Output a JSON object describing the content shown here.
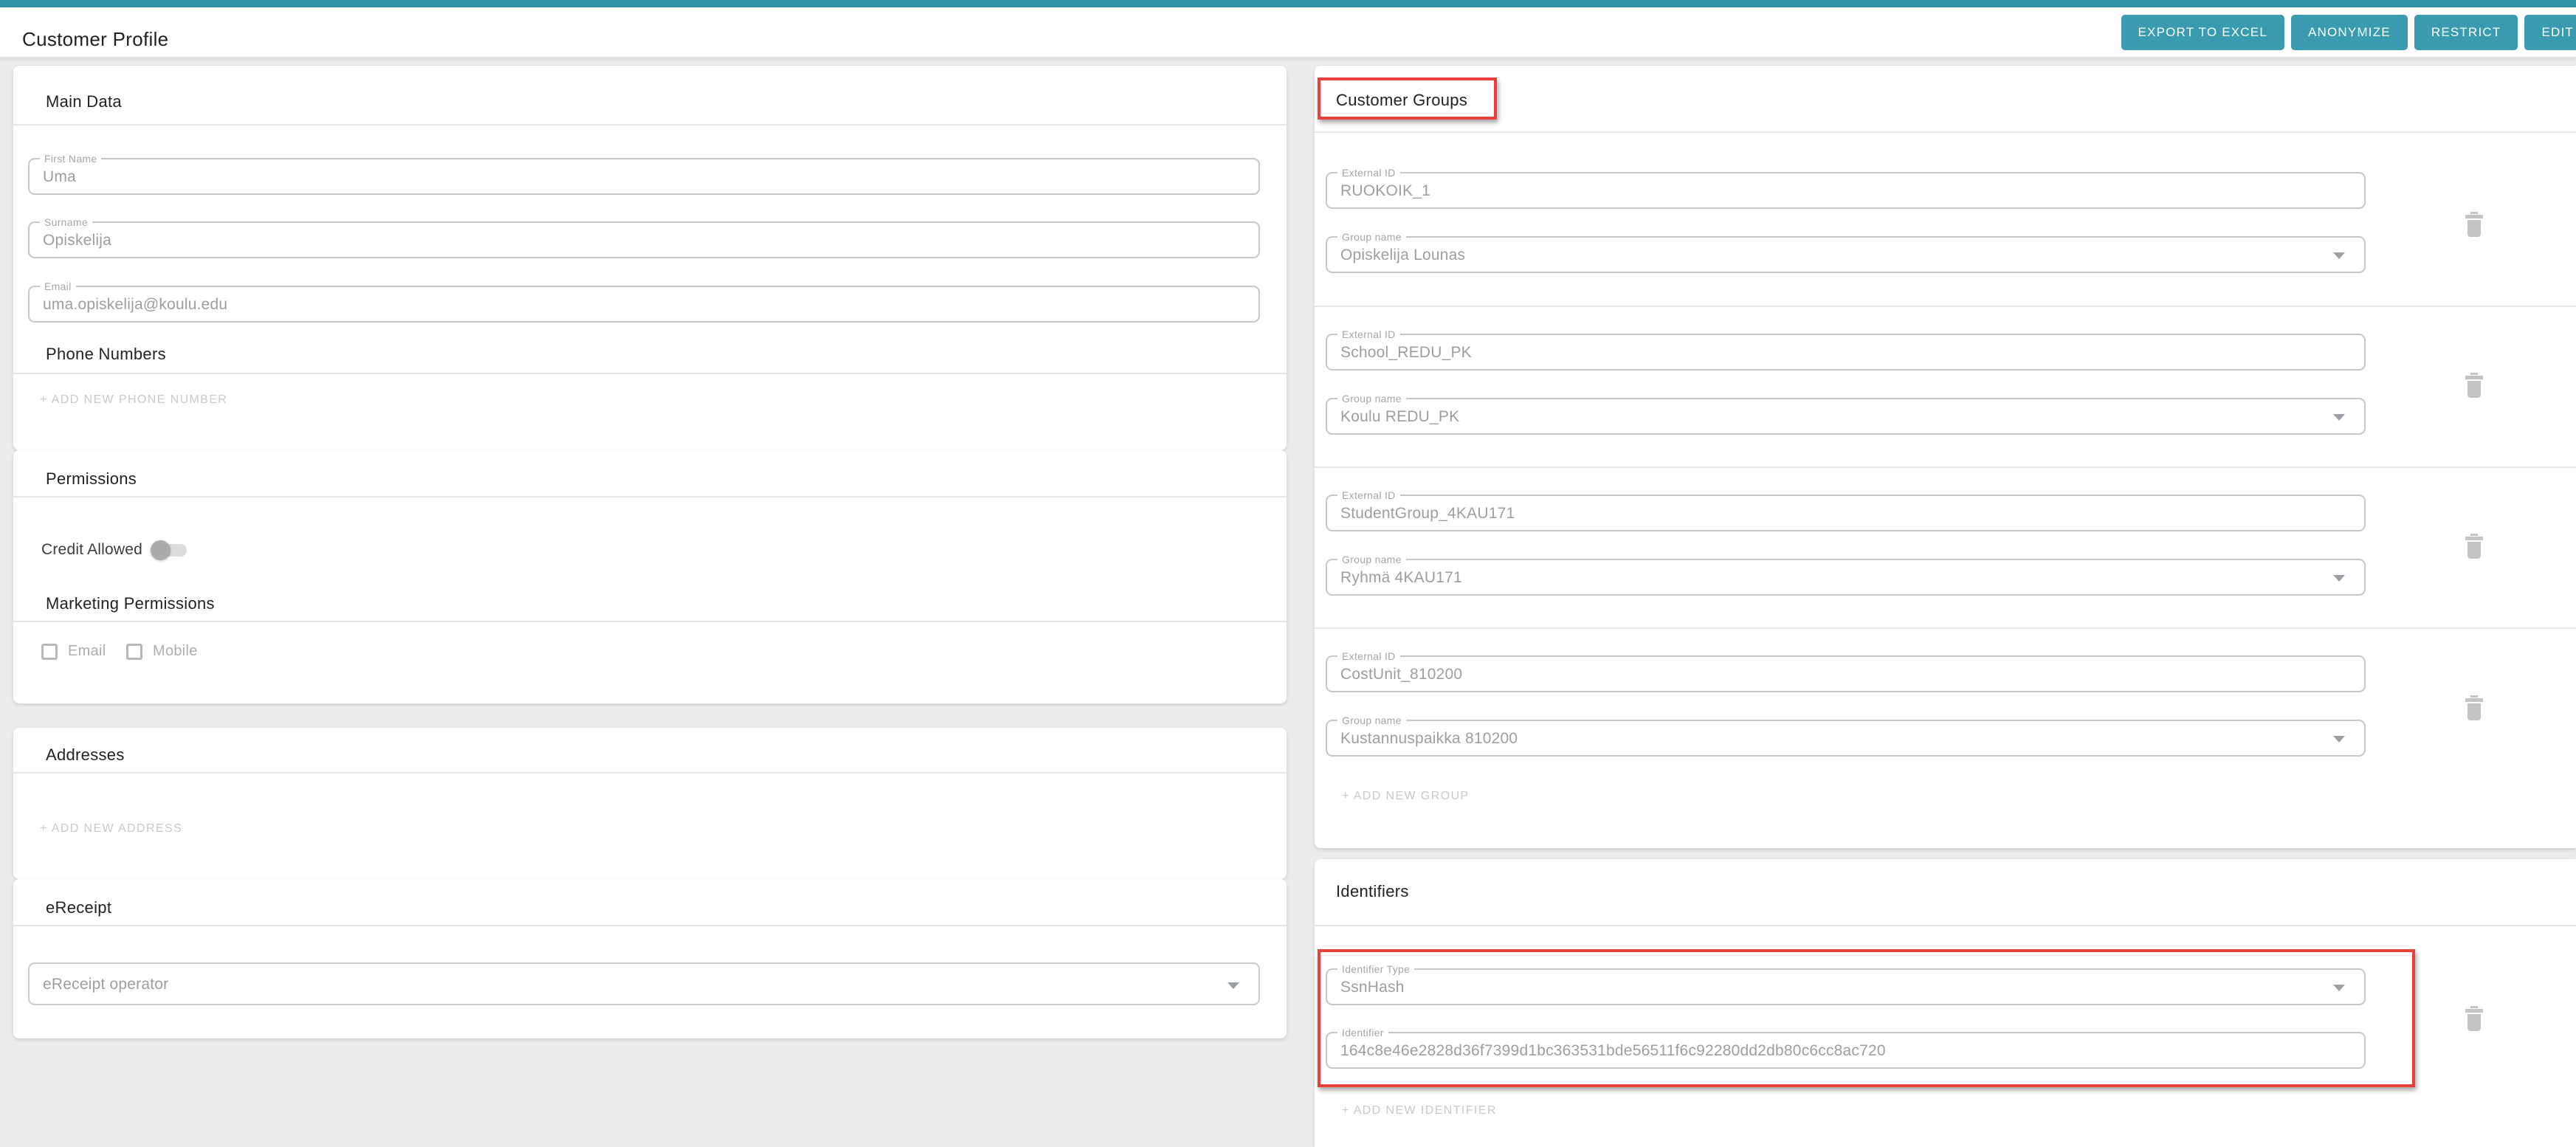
{
  "app": {
    "title": "Customer Profile"
  },
  "theme": {
    "topbar_color": "#2e93a8",
    "button_color": "#399ab0",
    "annotation_color": "#e8413d",
    "card_background": "#ffffff",
    "page_background": "#ececec"
  },
  "toolbar": {
    "buttons": [
      {
        "label": "EXPORT TO EXCEL"
      },
      {
        "label": "ANONYMIZE"
      },
      {
        "label": "RESTRICT"
      },
      {
        "label": "EDIT"
      }
    ]
  },
  "main_data": {
    "title": "Main Data",
    "fields": {
      "first_name": {
        "label": "First Name",
        "value": "Uma"
      },
      "surname": {
        "label": "Surname",
        "value": "Opiskelija"
      },
      "email": {
        "label": "Email",
        "value": "uma.opiskelija@koulu.edu"
      }
    }
  },
  "phone_numbers": {
    "title": "Phone Numbers",
    "add_label": "+ ADD NEW PHONE NUMBER"
  },
  "permissions": {
    "title": "Permissions",
    "credit_allowed_label": "Credit Allowed",
    "credit_allowed_enabled": false
  },
  "marketing_permissions": {
    "title": "Marketing Permissions",
    "options": [
      {
        "label": "Email",
        "checked": false
      },
      {
        "label": "Mobile",
        "checked": false
      }
    ]
  },
  "addresses": {
    "title": "Addresses",
    "add_label": "+ ADD NEW ADDRESS"
  },
  "ereceipt": {
    "title": "eReceipt",
    "operator_placeholder": "eReceipt operator"
  },
  "customer_groups": {
    "title": "Customer Groups",
    "external_id_label": "External ID",
    "group_name_label": "Group name",
    "add_label": "+ ADD NEW GROUP",
    "groups": [
      {
        "external_id": "RUOKOIK_1",
        "group_name": "Opiskelija Lounas"
      },
      {
        "external_id": "School_REDU_PK",
        "group_name": "Koulu REDU_PK"
      },
      {
        "external_id": "StudentGroup_4KAU171",
        "group_name": "Ryhmä 4KAU171"
      },
      {
        "external_id": "CostUnit_810200",
        "group_name": "Kustannuspaikka 810200"
      }
    ]
  },
  "identifiers": {
    "title": "Identifiers",
    "type_label": "Identifier Type",
    "identifier_label": "Identifier",
    "add_label": "+ ADD NEW IDENTIFIER",
    "items": [
      {
        "type": "SsnHash",
        "identifier": "164c8e46e2828d36f7399d1bc363531bde56511f6c92280dd2db80c6cc8ac720"
      }
    ]
  }
}
